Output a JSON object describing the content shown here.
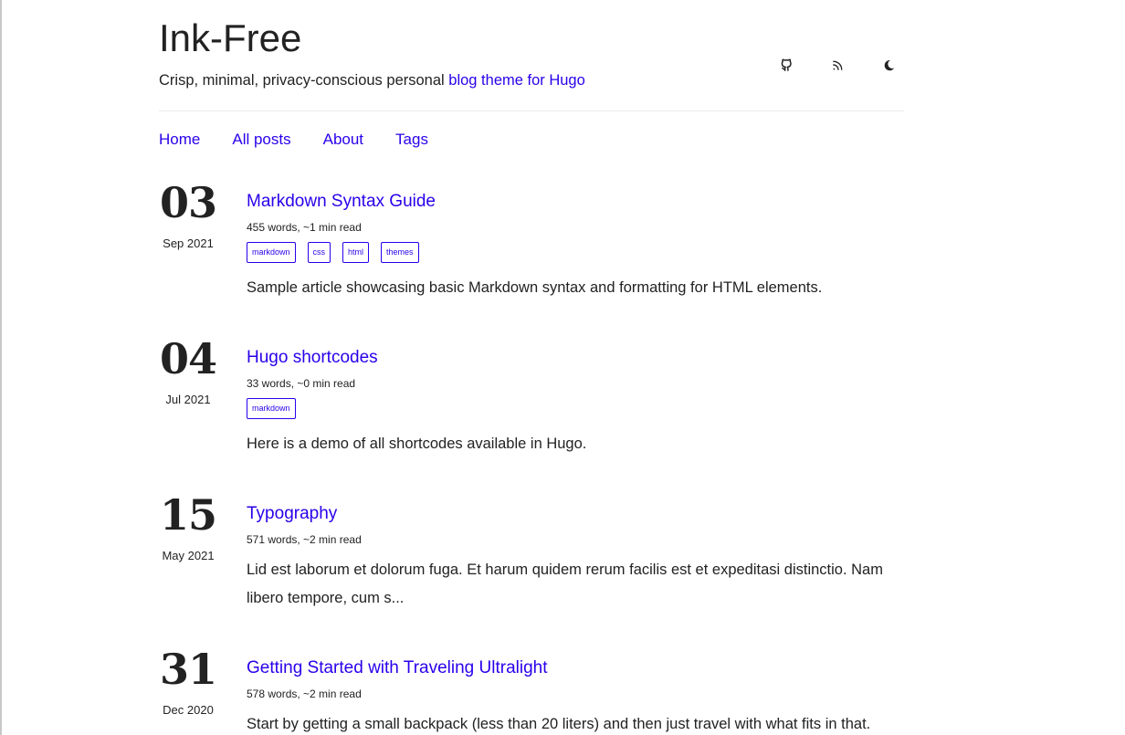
{
  "site": {
    "title": "Ink-Free",
    "tagline_prefix": "Crisp, minimal, privacy-conscious personal ",
    "tagline_link": "blog theme for Hugo"
  },
  "header_icons": [
    "github-icon",
    "rss-icon",
    "dark-mode-moon-icon"
  ],
  "nav": [
    {
      "label": "Home"
    },
    {
      "label": "All posts"
    },
    {
      "label": "About"
    },
    {
      "label": "Tags"
    }
  ],
  "posts": [
    {
      "day": "03",
      "month": "Sep 2021",
      "title": "Markdown Syntax Guide",
      "meta": "455 words, ~1 min read",
      "tags": [
        "markdown",
        "css",
        "html",
        "themes"
      ],
      "excerpt": "Sample article showcasing basic Markdown syntax and formatting for HTML elements."
    },
    {
      "day": "04",
      "month": "Jul 2021",
      "title": "Hugo shortcodes",
      "meta": "33 words, ~0 min read",
      "tags": [
        "markdown"
      ],
      "excerpt": "Here is a demo of all shortcodes available in Hugo."
    },
    {
      "day": "15",
      "month": "May 2021",
      "title": "Typography",
      "meta": "571 words, ~2 min read",
      "tags": [],
      "excerpt": "Lid est laborum et dolorum fuga. Et harum quidem rerum facilis est et expeditasi distinctio. Nam libero tempore, cum s..."
    },
    {
      "day": "31",
      "month": "Dec 2020",
      "title": "Getting Started with Traveling Ultralight",
      "meta": "578 words, ~2 min read",
      "tags": [],
      "excerpt": "Start by getting a small backpack (less than 20 liters) and then just travel with what fits in that."
    }
  ],
  "colors": {
    "link": "#2a00ea",
    "text": "#222222",
    "divider": "#ececec"
  }
}
